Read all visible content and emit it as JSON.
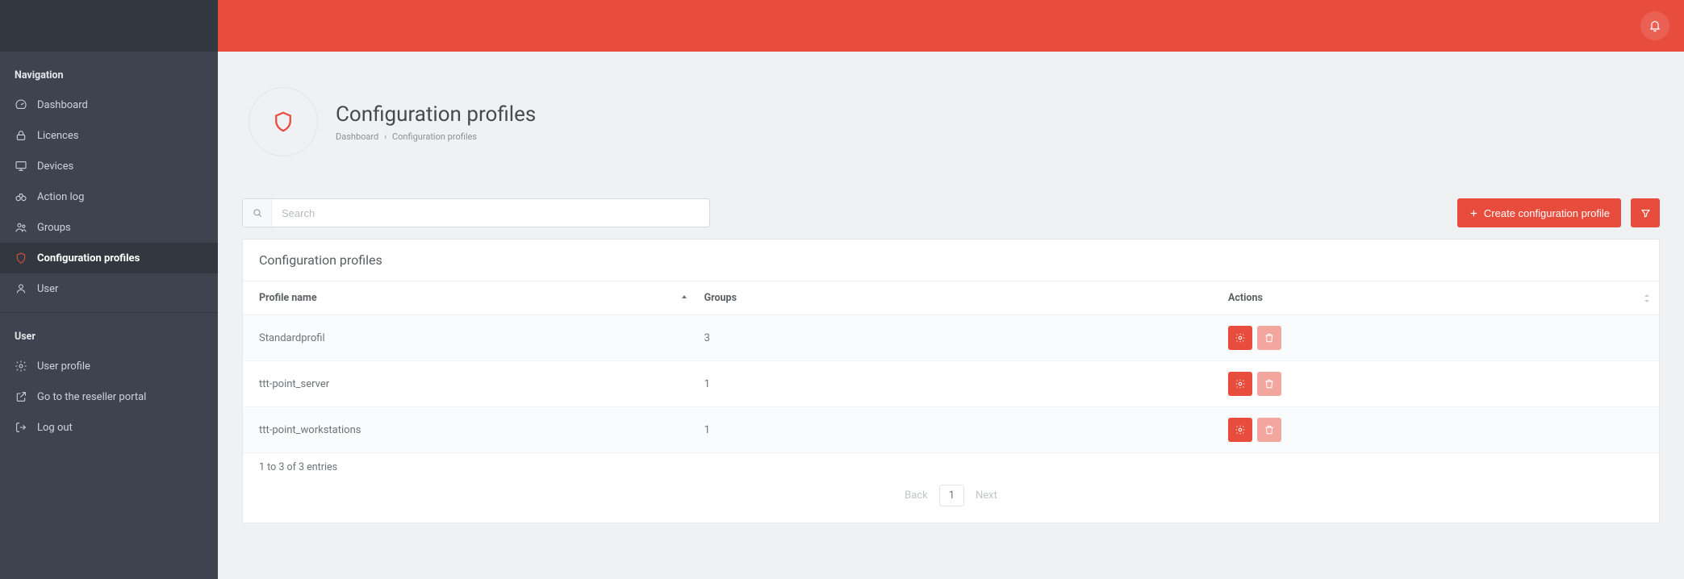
{
  "sidebar": {
    "navigation_title": "Navigation",
    "user_title": "User",
    "nav_items": [
      {
        "label": "Dashboard",
        "icon": "gauge-icon",
        "active": false
      },
      {
        "label": "Licences",
        "icon": "lock-icon",
        "active": false
      },
      {
        "label": "Devices",
        "icon": "monitor-icon",
        "active": false
      },
      {
        "label": "Action log",
        "icon": "binoculars-icon",
        "active": false
      },
      {
        "label": "Groups",
        "icon": "users-icon",
        "active": false
      },
      {
        "label": "Configuration profiles",
        "icon": "shield-icon",
        "active": true
      },
      {
        "label": "User",
        "icon": "user-icon",
        "active": false
      }
    ],
    "user_items": [
      {
        "label": "User profile",
        "icon": "gear-icon"
      },
      {
        "label": "Go to the reseller portal",
        "icon": "external-icon"
      },
      {
        "label": "Log out",
        "icon": "logout-icon"
      }
    ]
  },
  "page": {
    "title": "Configuration profiles",
    "breadcrumb": {
      "root": "Dashboard",
      "current": "Configuration profiles"
    }
  },
  "toolbar": {
    "search_placeholder": "Search",
    "create_label": "Create configuration profile"
  },
  "panel": {
    "title": "Configuration profiles",
    "columns": {
      "profile_name": "Profile name",
      "groups": "Groups",
      "actions": "Actions"
    },
    "rows": [
      {
        "name": "Standardprofil",
        "groups": "3"
      },
      {
        "name": "ttt-point_server",
        "groups": "1"
      },
      {
        "name": "ttt-point_workstations",
        "groups": "1"
      }
    ],
    "entries_text": "1 to 3 of 3 entries",
    "pagination": {
      "back": "Back",
      "page": "1",
      "next": "Next"
    }
  }
}
